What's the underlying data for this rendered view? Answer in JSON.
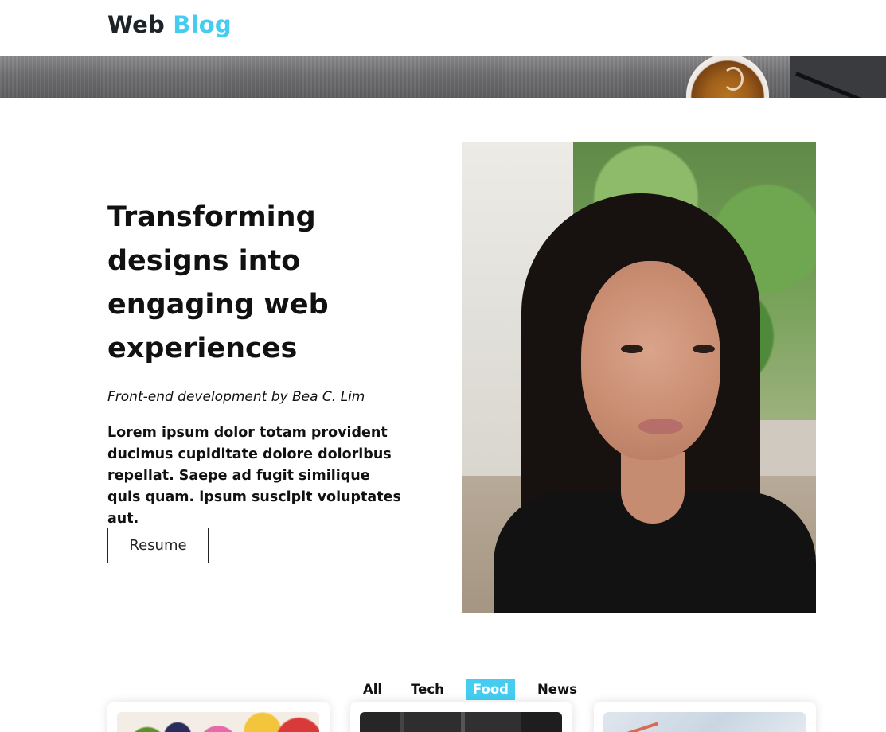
{
  "header": {
    "logo_part1": "Web",
    "logo_part2": "Blog",
    "accent_color": "#44cdf0"
  },
  "hero": {
    "title": "Transforming designs into engaging web experiences",
    "byline": "Front-end development by Bea C. Lim",
    "description": "Lorem ipsum dolor totam provident ducimus cupiditate dolore doloribus repellat. Saepe ad fugit similique quis quam. ipsum suscipit voluptates aut.",
    "button_label": "Resume"
  },
  "filters": {
    "items": [
      {
        "label": "All",
        "active": false
      },
      {
        "label": "Tech",
        "active": false
      },
      {
        "label": "Food",
        "active": true
      },
      {
        "label": "News",
        "active": false
      }
    ]
  }
}
